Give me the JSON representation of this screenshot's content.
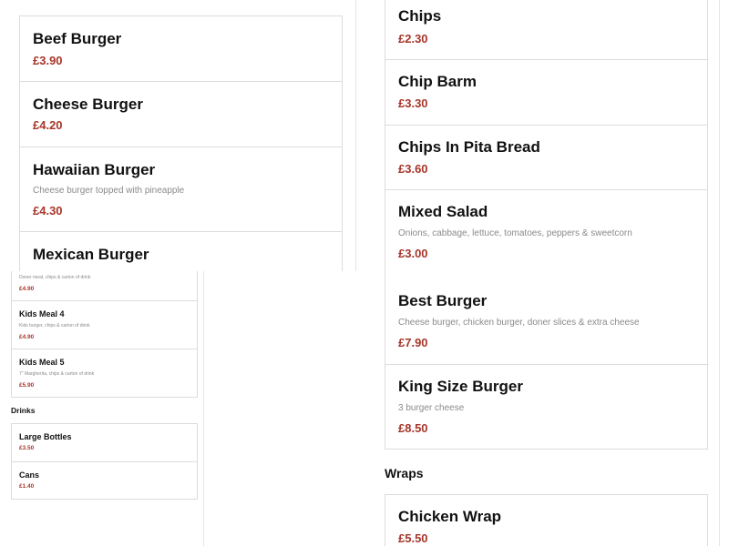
{
  "top_left": {
    "items": [
      {
        "name": "Beef Burger",
        "description": "",
        "price": "£3.90"
      },
      {
        "name": "Cheese Burger",
        "description": "",
        "price": "£4.20"
      },
      {
        "name": "Hawaiian Burger",
        "description": "Cheese burger topped with pineapple",
        "price": "£4.30"
      },
      {
        "name": "Mexican Burger",
        "description": "",
        "price": ""
      }
    ]
  },
  "top_right": {
    "items": [
      {
        "name": "Chips",
        "description": "",
        "price": "£2.30"
      },
      {
        "name": "Chip Barm",
        "description": "",
        "price": "£3.30"
      },
      {
        "name": "Chips In Pita Bread",
        "description": "",
        "price": "£3.60"
      },
      {
        "name": "Mixed Salad",
        "description": "Onions, cabbage, lettuce, tomatoes, peppers & sweetcorn",
        "price": "£3.00"
      }
    ]
  },
  "bottom_left": {
    "kids_meals": [
      {
        "name": "",
        "description": "Doner meat, chips & carton of drink",
        "price": "£4.90"
      },
      {
        "name": "Kids Meal 4",
        "description": "Kids burger, chips & carton of drink",
        "price": "£4.90"
      },
      {
        "name": "Kids Meal 5",
        "description": "7\" Margherita, chips & carton of drink",
        "price": "£5.90"
      }
    ],
    "drinks_heading": "Drinks",
    "drinks": [
      {
        "name": "Large Bottles",
        "price": "£3.50"
      },
      {
        "name": "Cans",
        "price": "£1.40"
      }
    ]
  },
  "bottom_right": {
    "burgers": [
      {
        "name": "Best Burger",
        "description": "Cheese burger, chicken burger, doner slices & extra cheese",
        "price": "£7.90"
      },
      {
        "name": "King Size Burger",
        "description": "3 burger cheese",
        "price": "£8.50"
      }
    ],
    "wraps_heading": "Wraps",
    "wraps": [
      {
        "name": "Chicken Wrap",
        "price": "£5.50"
      }
    ]
  },
  "colors": {
    "price": "#a7362a",
    "border": "#dcdcdc",
    "description": "#8a8a8a"
  }
}
